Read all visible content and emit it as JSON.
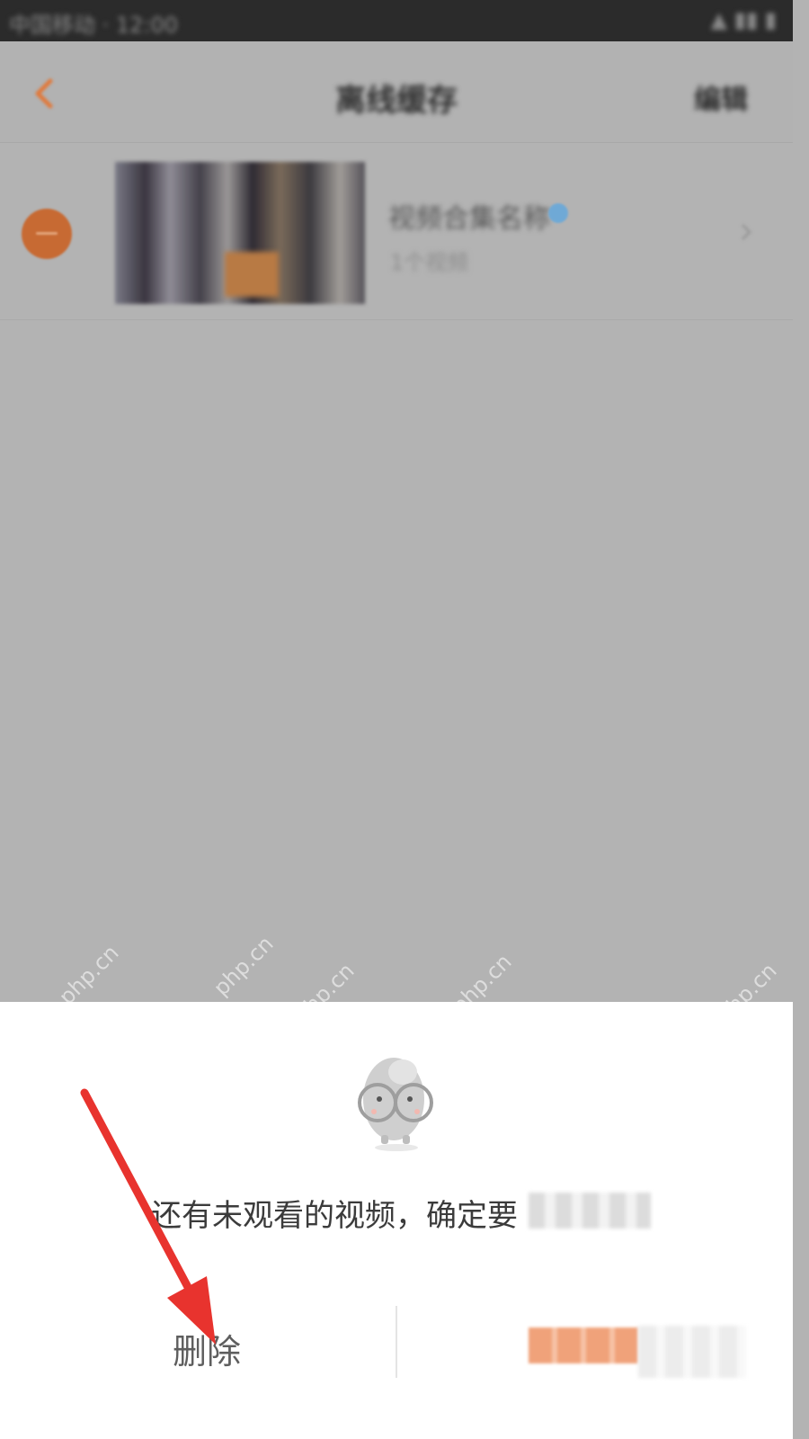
{
  "status_bar": {
    "left_text": "中国移动 · 12:00",
    "right_text": "▲ ▮▮ ▮"
  },
  "nav": {
    "title": "离线缓存",
    "edit_label": "编辑"
  },
  "cache_item": {
    "title": "视频合集名称",
    "subtitle": "1个视频"
  },
  "watermarks": [
    "php.cn",
    "php.cn",
    "php.cn",
    "php.cn",
    "php.cn"
  ],
  "dialog": {
    "message": "还有未观看的视频，确定要",
    "delete_label": "删除",
    "accent_color": "#f0a27a"
  },
  "annotation": {
    "arrow_color": "#e8332e"
  }
}
